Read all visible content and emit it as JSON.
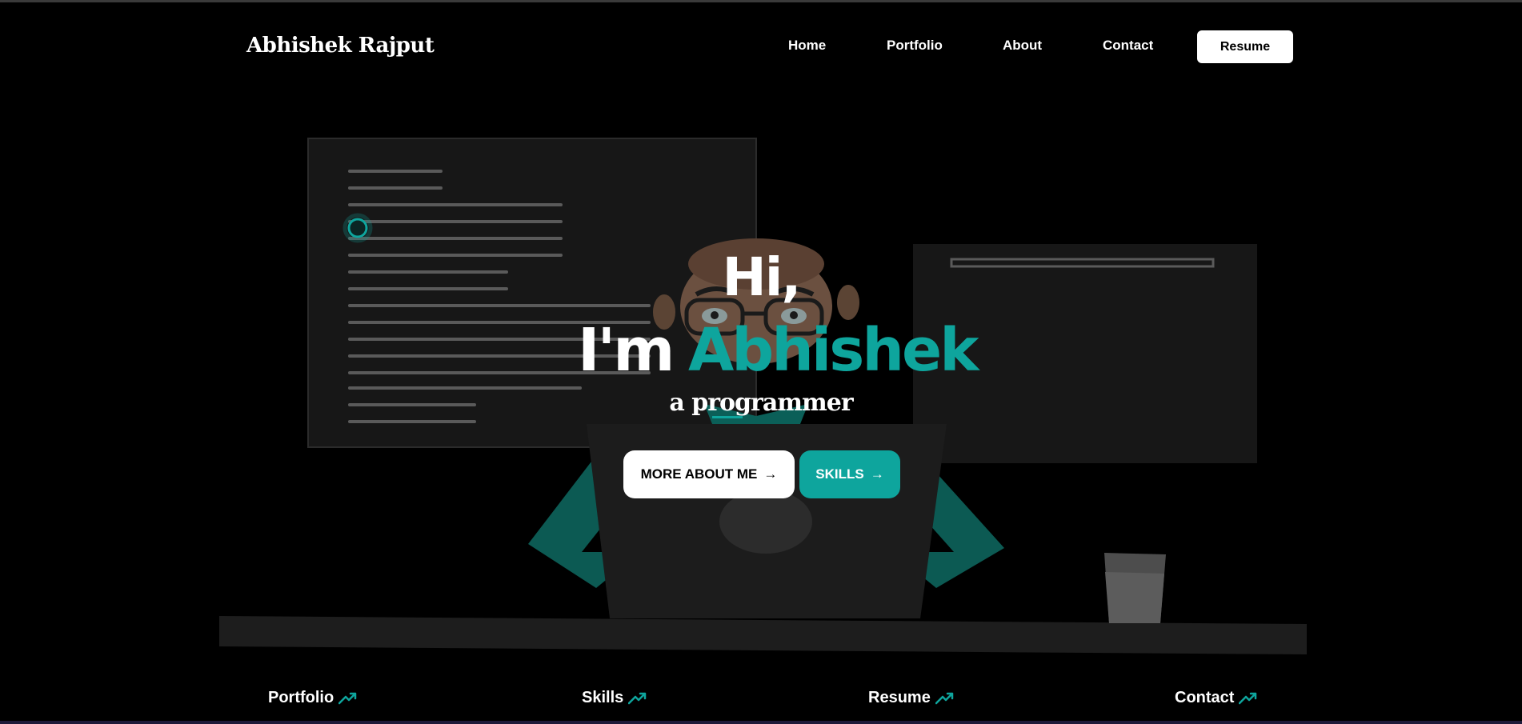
{
  "brand": {
    "name": "Abhishek Rajput"
  },
  "nav": {
    "items": [
      "Home",
      "Portfolio",
      "About",
      "Contact"
    ],
    "resume": "Resume"
  },
  "hero": {
    "greeting": "Hi,",
    "intro": "I'm",
    "name": "Abhishek",
    "subtitle": "a programmer",
    "btn_about": "MORE ABOUT ME",
    "btn_skills": "SKILLS",
    "arrow": "→"
  },
  "footer_links": [
    {
      "label": "Portfolio",
      "icon": "trending-up-icon"
    },
    {
      "label": "Skills",
      "icon": "trending-up-icon"
    },
    {
      "label": "Resume",
      "icon": "trending-up-icon"
    },
    {
      "label": "Contact",
      "icon": "trending-up-icon"
    }
  ],
  "colors": {
    "accent": "#0ea59d",
    "background": "#000000",
    "panel": "#171717"
  }
}
